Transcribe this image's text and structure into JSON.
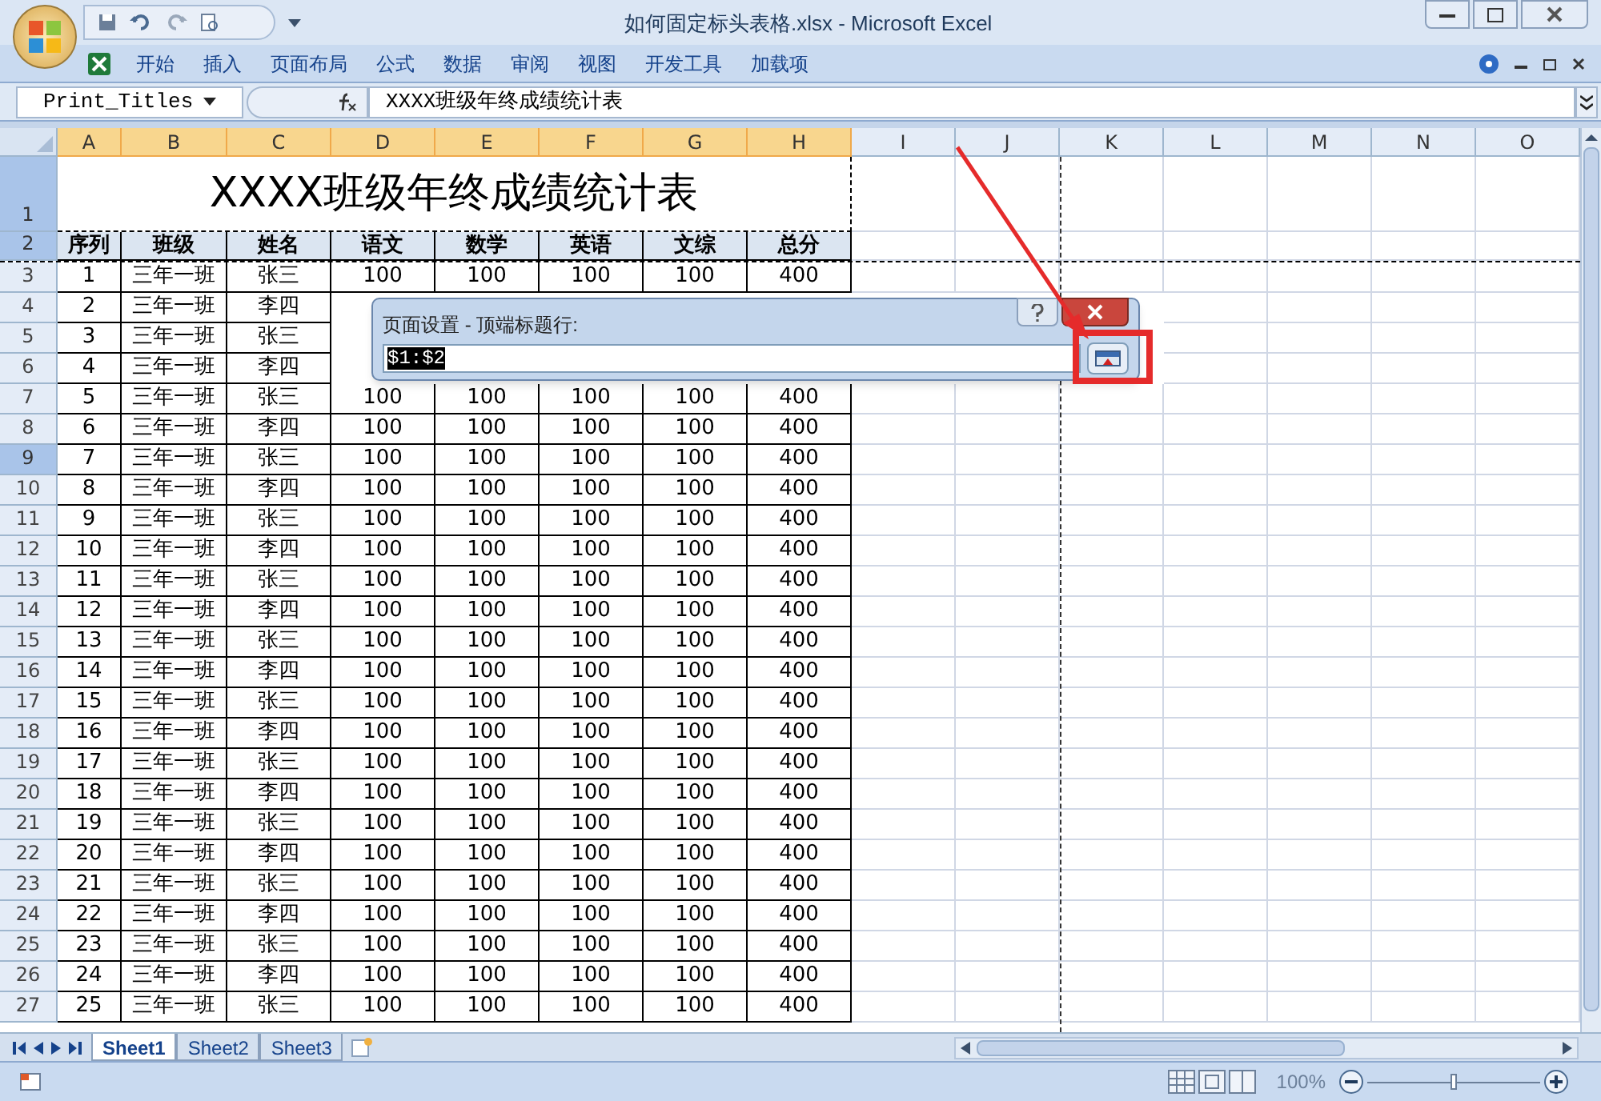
{
  "window": {
    "title": "如何固定标头表格.xlsx - Microsoft Excel"
  },
  "ribbon_tabs": [
    "开始",
    "插入",
    "页面布局",
    "公式",
    "数据",
    "审阅",
    "视图",
    "开发工具",
    "加载项"
  ],
  "formula_bar": {
    "name_box": "Print_Titles",
    "formula": "XXXX班级年终成绩统计表"
  },
  "columns": [
    {
      "label": "A",
      "selected": true
    },
    {
      "label": "B",
      "selected": true
    },
    {
      "label": "C",
      "selected": true
    },
    {
      "label": "D",
      "selected": true
    },
    {
      "label": "E",
      "selected": true
    },
    {
      "label": "F",
      "selected": true
    },
    {
      "label": "G",
      "selected": true
    },
    {
      "label": "H",
      "selected": true
    },
    {
      "label": "I",
      "selected": false
    },
    {
      "label": "J",
      "selected": false
    },
    {
      "label": "K",
      "selected": false
    },
    {
      "label": "L",
      "selected": false
    },
    {
      "label": "M",
      "selected": false
    },
    {
      "label": "N",
      "selected": false
    },
    {
      "label": "O",
      "selected": false
    }
  ],
  "title_row": {
    "header": "1",
    "selected": true,
    "text": "XXXX班级年终成绩统计表"
  },
  "header_row": {
    "header": "2",
    "selected": true,
    "cells": [
      "序列",
      "班级",
      "姓名",
      "语文",
      "数学",
      "英语",
      "文综",
      "总分"
    ]
  },
  "data_rows": [
    {
      "header": "3",
      "selected": false,
      "cells": [
        "1",
        "三年一班",
        "张三",
        "100",
        "100",
        "100",
        "100",
        "400"
      ]
    },
    {
      "header": "4",
      "selected": false,
      "cells": [
        "2",
        "三年一班",
        "李四"
      ]
    },
    {
      "header": "5",
      "selected": false,
      "cells": [
        "3",
        "三年一班",
        "张三"
      ]
    },
    {
      "header": "6",
      "selected": false,
      "cells": [
        "4",
        "三年一班",
        "李四"
      ]
    },
    {
      "header": "7",
      "selected": false,
      "cells": [
        "5",
        "三年一班",
        "张三",
        "100",
        "100",
        "100",
        "100",
        "400"
      ]
    },
    {
      "header": "8",
      "selected": false,
      "cells": [
        "6",
        "三年一班",
        "李四",
        "100",
        "100",
        "100",
        "100",
        "400"
      ]
    },
    {
      "header": "9",
      "selected": true,
      "cells": [
        "7",
        "三年一班",
        "张三",
        "100",
        "100",
        "100",
        "100",
        "400"
      ]
    },
    {
      "header": "10",
      "selected": false,
      "cells": [
        "8",
        "三年一班",
        "李四",
        "100",
        "100",
        "100",
        "100",
        "400"
      ]
    },
    {
      "header": "11",
      "selected": false,
      "cells": [
        "9",
        "三年一班",
        "张三",
        "100",
        "100",
        "100",
        "100",
        "400"
      ]
    },
    {
      "header": "12",
      "selected": false,
      "cells": [
        "10",
        "三年一班",
        "李四",
        "100",
        "100",
        "100",
        "100",
        "400"
      ]
    },
    {
      "header": "13",
      "selected": false,
      "cells": [
        "11",
        "三年一班",
        "张三",
        "100",
        "100",
        "100",
        "100",
        "400"
      ]
    },
    {
      "header": "14",
      "selected": false,
      "cells": [
        "12",
        "三年一班",
        "李四",
        "100",
        "100",
        "100",
        "100",
        "400"
      ]
    },
    {
      "header": "15",
      "selected": false,
      "cells": [
        "13",
        "三年一班",
        "张三",
        "100",
        "100",
        "100",
        "100",
        "400"
      ]
    },
    {
      "header": "16",
      "selected": false,
      "cells": [
        "14",
        "三年一班",
        "李四",
        "100",
        "100",
        "100",
        "100",
        "400"
      ]
    },
    {
      "header": "17",
      "selected": false,
      "cells": [
        "15",
        "三年一班",
        "张三",
        "100",
        "100",
        "100",
        "100",
        "400"
      ]
    },
    {
      "header": "18",
      "selected": false,
      "cells": [
        "16",
        "三年一班",
        "李四",
        "100",
        "100",
        "100",
        "100",
        "400"
      ]
    },
    {
      "header": "19",
      "selected": false,
      "cells": [
        "17",
        "三年一班",
        "张三",
        "100",
        "100",
        "100",
        "100",
        "400"
      ]
    },
    {
      "header": "20",
      "selected": false,
      "cells": [
        "18",
        "三年一班",
        "李四",
        "100",
        "100",
        "100",
        "100",
        "400"
      ]
    },
    {
      "header": "21",
      "selected": false,
      "cells": [
        "19",
        "三年一班",
        "张三",
        "100",
        "100",
        "100",
        "100",
        "400"
      ]
    },
    {
      "header": "22",
      "selected": false,
      "cells": [
        "20",
        "三年一班",
        "李四",
        "100",
        "100",
        "100",
        "100",
        "400"
      ]
    },
    {
      "header": "23",
      "selected": false,
      "cells": [
        "21",
        "三年一班",
        "张三",
        "100",
        "100",
        "100",
        "100",
        "400"
      ]
    },
    {
      "header": "24",
      "selected": false,
      "cells": [
        "22",
        "三年一班",
        "李四",
        "100",
        "100",
        "100",
        "100",
        "400"
      ]
    },
    {
      "header": "25",
      "selected": false,
      "cells": [
        "23",
        "三年一班",
        "张三",
        "100",
        "100",
        "100",
        "100",
        "400"
      ]
    },
    {
      "header": "26",
      "selected": false,
      "cells": [
        "24",
        "三年一班",
        "李四",
        "100",
        "100",
        "100",
        "100",
        "400"
      ]
    },
    {
      "header": "27",
      "selected": false,
      "cells": [
        "25",
        "三年一班",
        "张三",
        "100",
        "100",
        "100",
        "100",
        "400"
      ]
    }
  ],
  "dialog": {
    "title": "页面设置 - 顶端标题行:",
    "value": "$1:$2"
  },
  "sheet_tabs": [
    {
      "label": "Sheet1",
      "selected": true
    },
    {
      "label": "Sheet2",
      "selected": false
    },
    {
      "label": "Sheet3",
      "selected": false
    }
  ],
  "status_bar": {
    "zoom": "100%",
    "zoom_slider": {
      "level": 0.5
    }
  }
}
